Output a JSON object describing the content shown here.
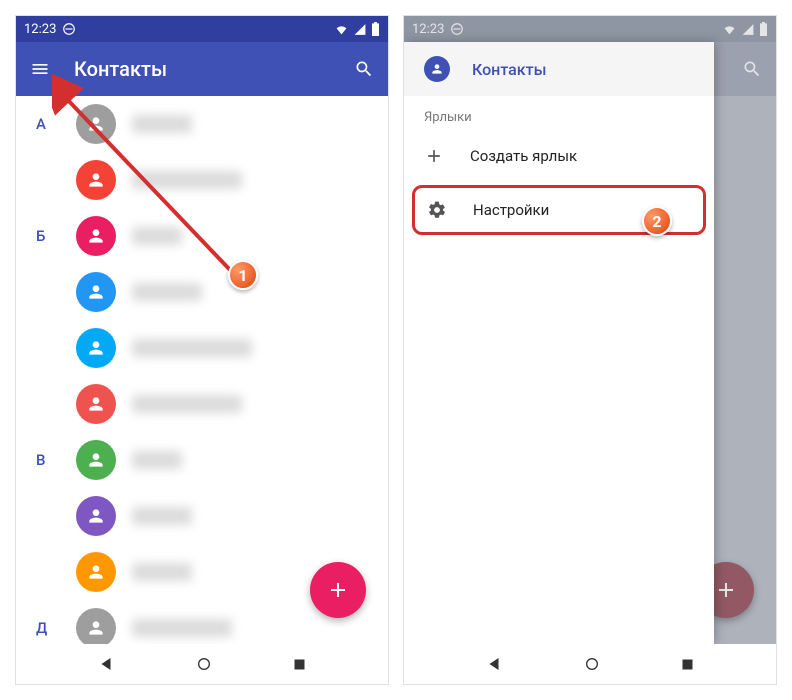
{
  "status": {
    "time": "12:23"
  },
  "left": {
    "header": {
      "title": "Контакты"
    },
    "sections": [
      {
        "letter": "А"
      },
      {
        "letter": "Б"
      },
      {
        "letter": "В"
      },
      {
        "letter": "Д"
      }
    ],
    "contacts": [
      {
        "color": "#9e9e9e",
        "width": 60
      },
      {
        "color": "#f44336",
        "width": 110
      },
      {
        "color": "#e91e63",
        "width": 50
      },
      {
        "color": "#2196f3",
        "width": 70
      },
      {
        "color": "#03a9f4",
        "width": 120
      },
      {
        "color": "#ef5350",
        "width": 110
      },
      {
        "color": "#4caf50",
        "width": 50
      },
      {
        "color": "#7e57c2",
        "width": 60
      },
      {
        "color": "#ff9800",
        "width": 60
      },
      {
        "color": "#9e9e9e",
        "width": 100
      }
    ]
  },
  "right": {
    "header": {
      "title": "Контакты"
    },
    "drawer": {
      "title": "Контакты",
      "section_label": "Ярлыки",
      "create_label": "Создать ярлык",
      "settings_label": "Настройки"
    }
  },
  "callouts": {
    "one": "1",
    "two": "2"
  }
}
